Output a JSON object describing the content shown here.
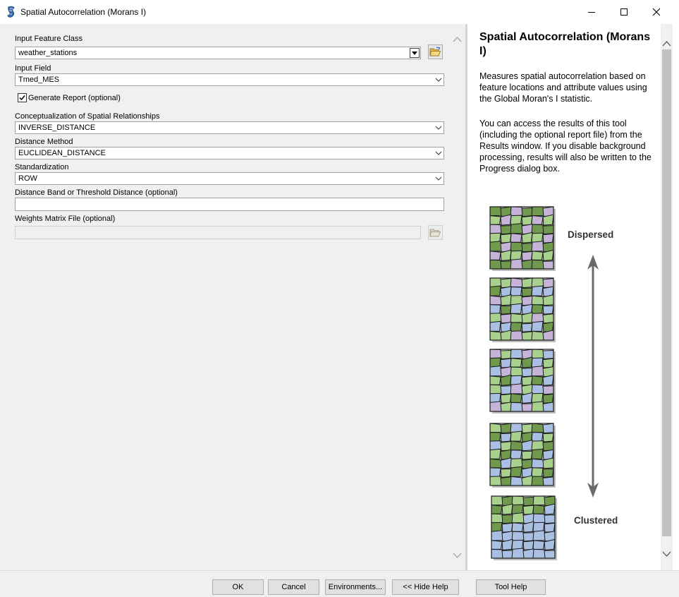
{
  "window": {
    "title": "Spatial Autocorrelation (Morans I)"
  },
  "form": {
    "input_feature_class": {
      "label": "Input Feature Class",
      "value": "weather_stations"
    },
    "input_field": {
      "label": "Input Field",
      "value": "Tmed_MES"
    },
    "generate_report": {
      "label": "Generate Report (optional)",
      "checked": true
    },
    "conceptualization": {
      "label": "Conceptualization of Spatial Relationships",
      "value": "INVERSE_DISTANCE"
    },
    "distance_method": {
      "label": "Distance Method",
      "value": "EUCLIDEAN_DISTANCE"
    },
    "standardization": {
      "label": "Standardization",
      "value": "ROW"
    },
    "distance_band": {
      "label": "Distance Band or Threshold Distance (optional)",
      "value": ""
    },
    "weights_matrix": {
      "label": "Weights Matrix File (optional)",
      "value": ""
    }
  },
  "help": {
    "title": "Spatial Autocorrelation (Morans I)",
    "paragraph1": "Measures spatial autocorrelation based on feature locations and attribute values using the Global Moran's I statistic.",
    "paragraph2": "You can access the results of this tool (including the optional report file) from the Results window. If you disable background processing, results will also be written to the Progress dialog box.",
    "figure": {
      "top_label": "Dispersed",
      "bottom_label": "Clustered"
    }
  },
  "buttons": {
    "ok": "OK",
    "cancel": "Cancel",
    "environments": "Environments...",
    "hide_help": "<< Hide Help",
    "tool_help": "Tool Help"
  },
  "colors": {
    "green_dark": "#6f9a4e",
    "green_light": "#a9d18e",
    "blue": "#a9bfe3",
    "purple": "#c6b3d8"
  }
}
